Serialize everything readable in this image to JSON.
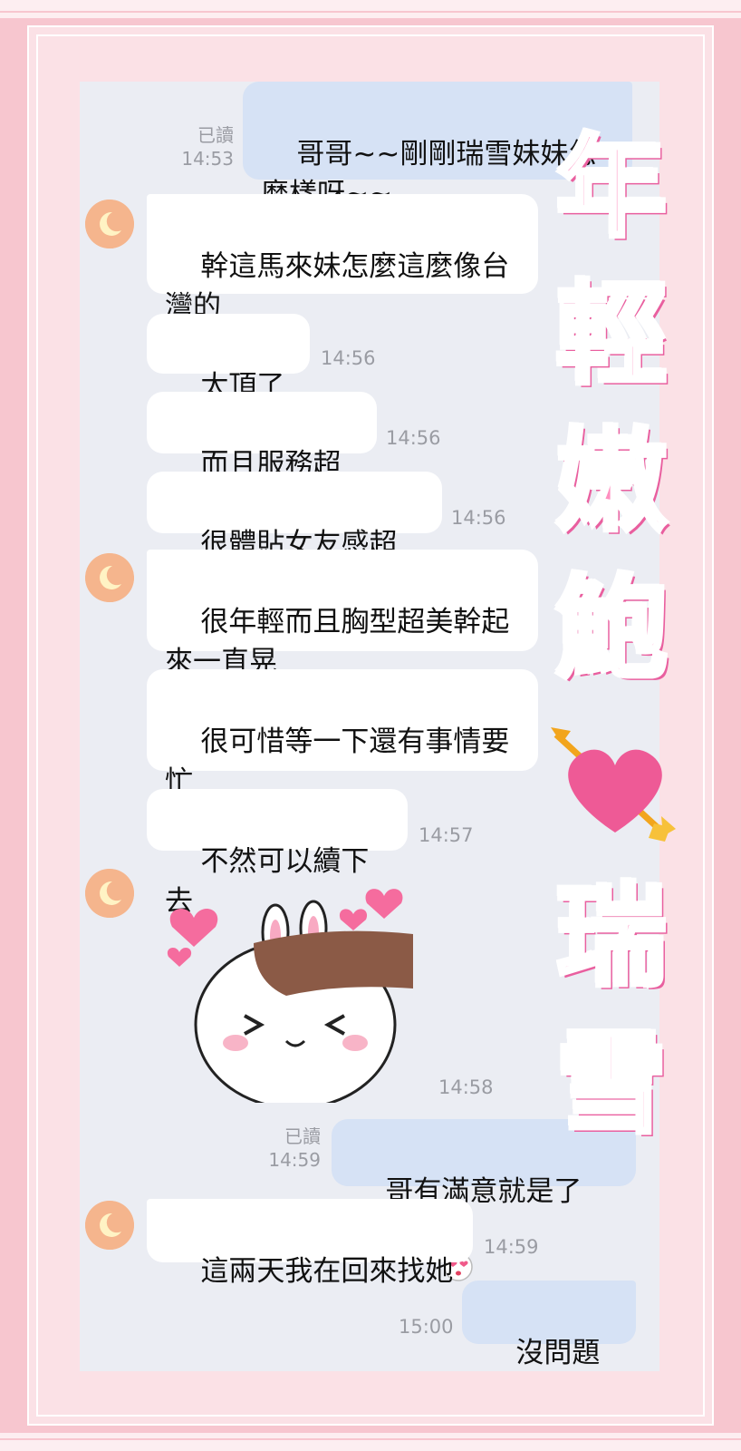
{
  "chat": {
    "messages": [
      {
        "side": "out",
        "text": "哥哥~~剛剛瑞雪妹妹怎\n麼樣呀~~",
        "read": "已讀",
        "time": "14:53"
      },
      {
        "side": "in",
        "text": "幹這馬來妹怎麼這麼像台\n灣的",
        "time": ""
      },
      {
        "side": "in",
        "text": "太頂了吧",
        "time": "14:56"
      },
      {
        "side": "in",
        "text": "而且服務超好",
        "time": "14:56"
      },
      {
        "side": "in",
        "text": "很體貼女友感超強",
        "time": "14:56"
      },
      {
        "side": "in",
        "text": "很年輕而且胸型超美幹起\n來一直晃",
        "time": ""
      },
      {
        "side": "in",
        "text": "很可惜等一下還有事情要\n忙",
        "time": ""
      },
      {
        "side": "in",
        "text": "不然可以續下去",
        "time": "14:57"
      },
      {
        "side": "in",
        "sticker": "bunny-sticker",
        "time": "14:58"
      },
      {
        "side": "out",
        "text": "哥有滿意就是了",
        "emoji": "heart-eyes-emoji",
        "read": "已讀",
        "time": "14:59"
      },
      {
        "side": "in",
        "text": "這兩天我在回來找她",
        "time": "14:59"
      },
      {
        "side": "out",
        "text": "沒問題~~",
        "time": "15:00"
      }
    ]
  },
  "overlay": {
    "title_chars_top": [
      "年",
      "輕",
      "嫩",
      "鮑"
    ],
    "title_chars_bottom": [
      "瑞",
      "雪"
    ],
    "heart_icon": "heart-with-arrow-icon"
  },
  "colors": {
    "page_background": "#f7c6cf",
    "chat_background": "#ebedf3",
    "incoming_bubble": "#ffffff",
    "outgoing_bubble": "#d6e2f5",
    "title_pink": "#ff8fc0",
    "avatar": "#f5b58d"
  }
}
